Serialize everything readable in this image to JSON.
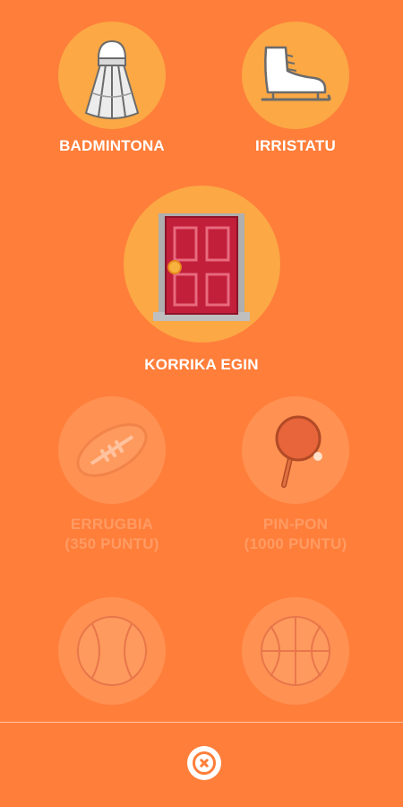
{
  "colors": {
    "background": "#FF7E3A",
    "circle": "#FBA845",
    "locked_circle": "#FF9152",
    "locked_text": "#FF9B63",
    "label": "#FFFFFF"
  },
  "activities": {
    "badminton": {
      "label": "BADMINTONA",
      "icon": "shuttlecock-icon",
      "locked": false
    },
    "skate": {
      "label": "IRRISTATU",
      "icon": "ice-skate-icon",
      "locked": false
    },
    "run": {
      "label": "KORRIKA EGIN",
      "icon": "door-icon",
      "locked": false
    },
    "rugby": {
      "label": "ERRUGBIA",
      "sublabel": "(350 PUNTU)",
      "icon": "rugby-ball-icon",
      "locked": true
    },
    "pingpong": {
      "label": "PIN-PON",
      "sublabel": "(1000 PUNTU)",
      "icon": "ping-pong-paddle-icon",
      "locked": true
    },
    "baseball": {
      "icon": "baseball-icon",
      "locked": true
    },
    "basketball": {
      "icon": "basketball-icon",
      "locked": true
    }
  },
  "footer": {
    "close_icon": "close-icon"
  }
}
